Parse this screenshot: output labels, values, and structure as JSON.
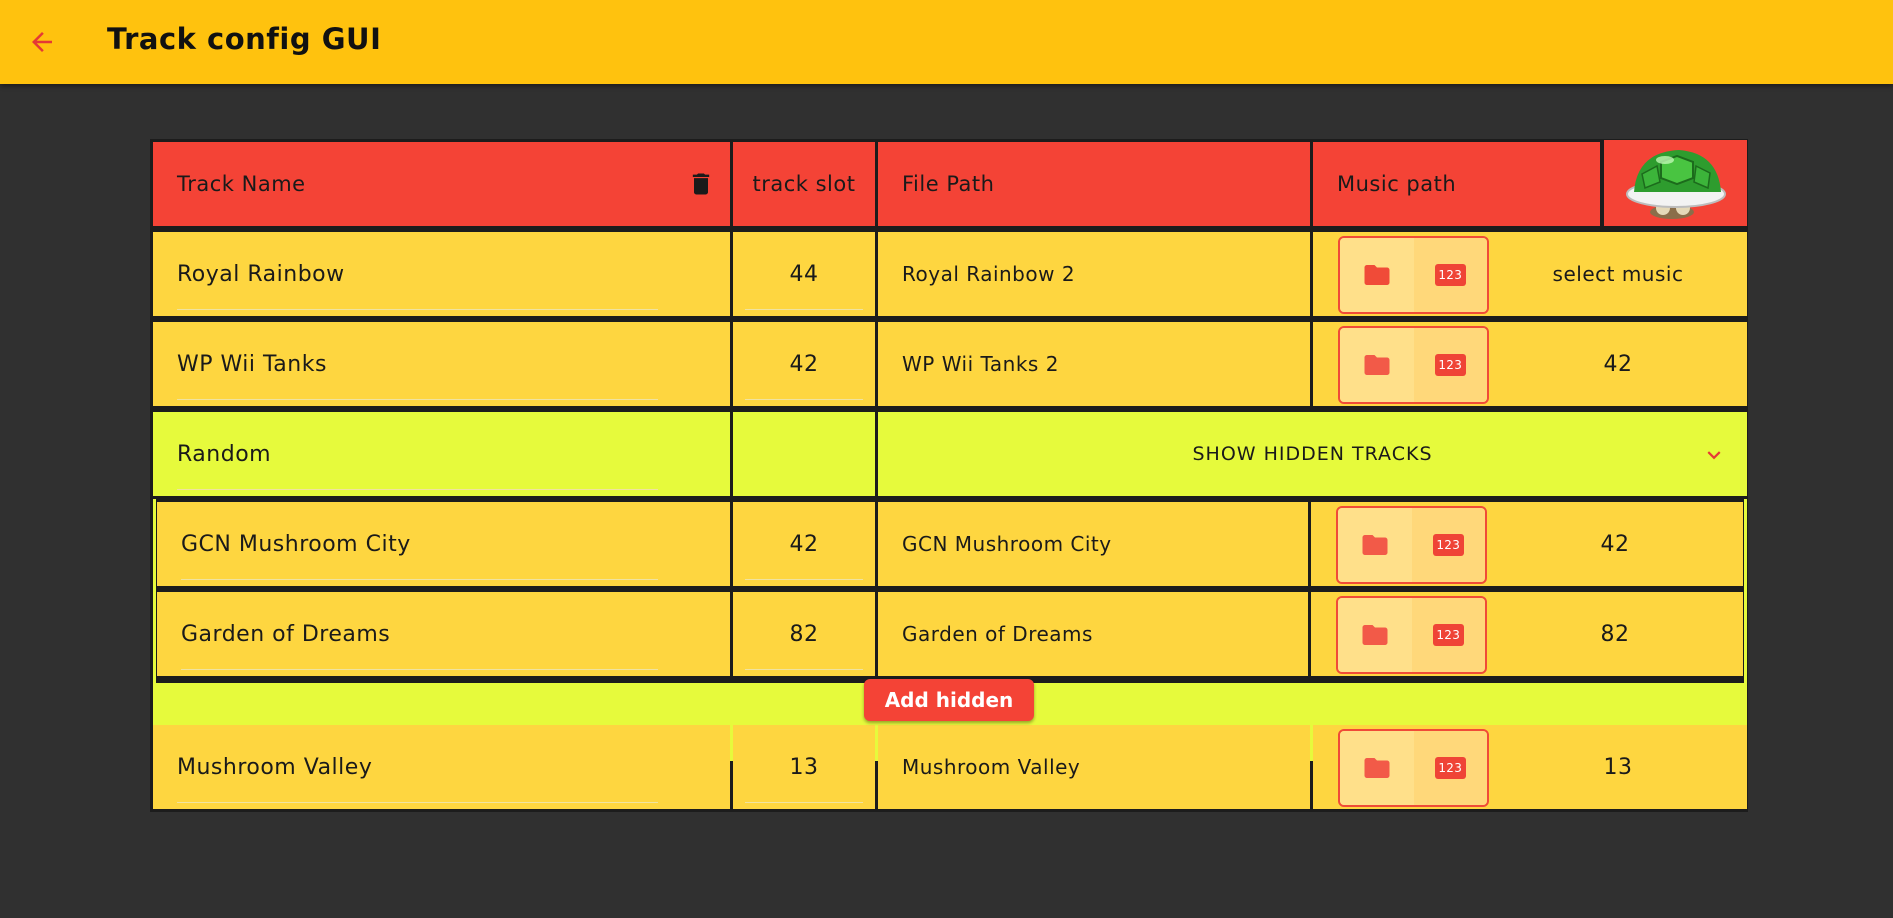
{
  "appbar": {
    "title": "Track config GUI",
    "back_icon": "arrow-back-icon"
  },
  "colors": {
    "appbar": "#ffc20e",
    "background": "#303030",
    "header_cell": "#f44336",
    "row_cell": "#fed640",
    "hidden_group": "#e6fa3c",
    "accent": "#ef4436"
  },
  "table": {
    "headers": {
      "track_name": "Track Name",
      "track_slot": "track slot",
      "file_path": "File Path",
      "music_path": "Music path",
      "delete_icon": "trash-icon",
      "shell_image": "green-shell-image"
    },
    "rows": [
      {
        "name": "Royal Rainbow",
        "slot": "44",
        "file_path": "Royal Rainbow 2",
        "music": "select music"
      },
      {
        "name": "WP Wii Tanks",
        "slot": "42",
        "file_path": "WP Wii Tanks 2",
        "music": "42"
      }
    ],
    "random_group": {
      "name": "Random",
      "toggle_label": "SHOW HIDDEN TRACKS",
      "toggle_icon": "chevron-down-icon",
      "hidden_rows": [
        {
          "name": "GCN Mushroom City",
          "slot": "42",
          "file_path": "GCN Mushroom City",
          "music": "42"
        },
        {
          "name": "Garden of Dreams",
          "slot": "82",
          "file_path": "Garden of Dreams",
          "music": "82"
        }
      ],
      "add_hidden_label": "Add hidden"
    },
    "last_row": {
      "name": "Mushroom Valley",
      "slot": "13",
      "file_path": "Mushroom Valley",
      "music": "13"
    },
    "row_icons": {
      "folder": "folder-icon",
      "number": "number-icon",
      "number_text": "123"
    }
  }
}
